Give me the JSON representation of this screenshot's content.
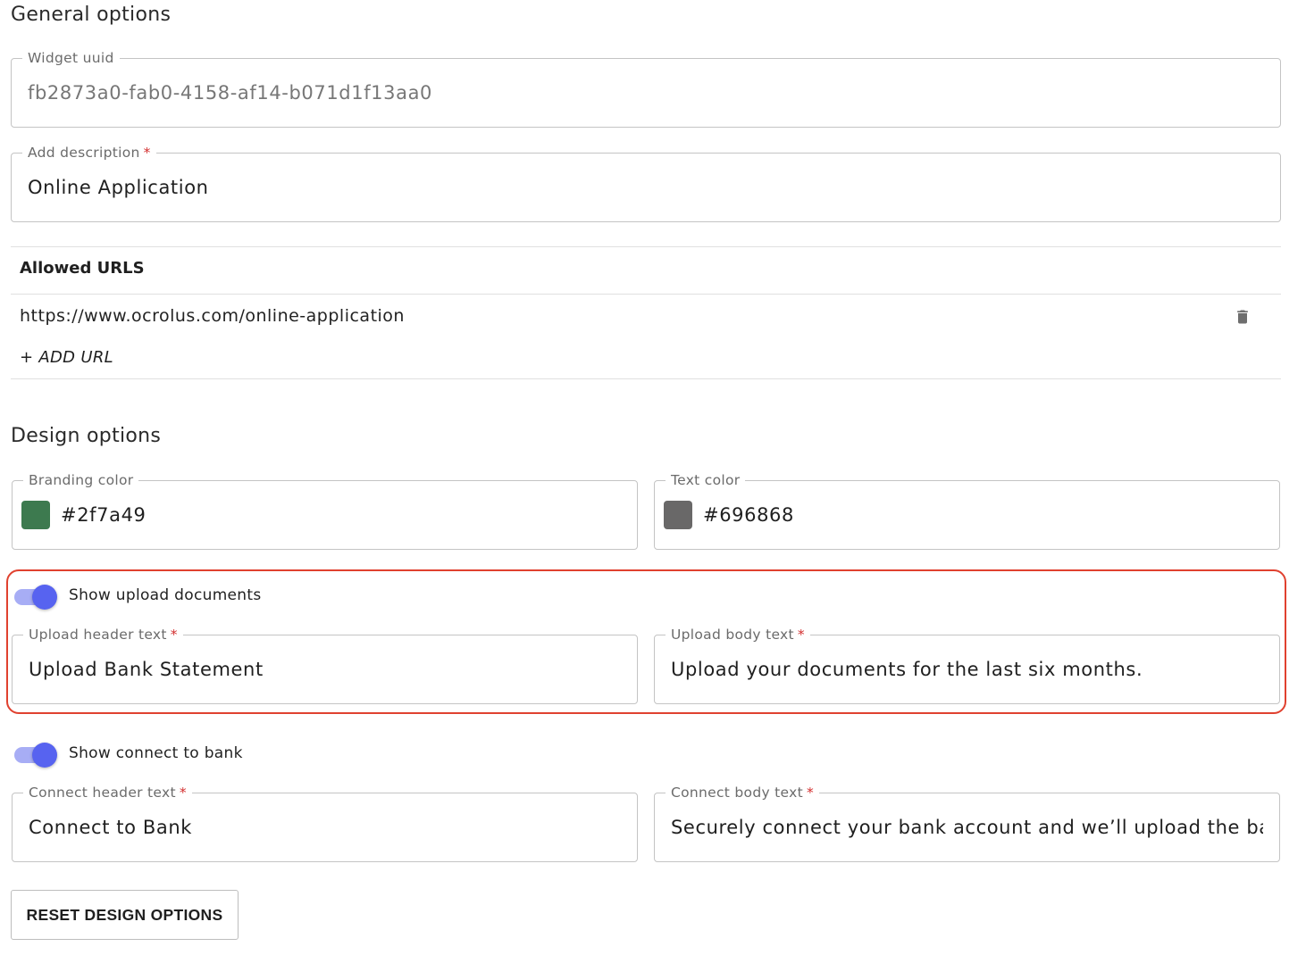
{
  "general": {
    "title": "General options",
    "widget_uuid": {
      "label": "Widget uuid",
      "value": "fb2873a0-fab0-4158-af14-b071d1f13aa0"
    },
    "description": {
      "label": "Add description",
      "required_mark": "*",
      "value": "Online Application"
    }
  },
  "allowed_urls": {
    "header": "Allowed URLS",
    "items": [
      {
        "url": "https://www.ocrolus.com/online-application",
        "delete_icon": "trash-icon"
      }
    ],
    "add_label": "+ ADD URL"
  },
  "design": {
    "title": "Design options",
    "branding_color": {
      "label": "Branding color",
      "value": "#2f7a49",
      "swatch": "#3d7a4f"
    },
    "text_color": {
      "label": "Text color",
      "value": "#696868",
      "swatch": "#696868"
    },
    "upload": {
      "toggle_label": "Show upload documents",
      "enabled": true,
      "header": {
        "label": "Upload header text",
        "required_mark": "*",
        "value": "Upload Bank Statement"
      },
      "body": {
        "label": "Upload body text",
        "required_mark": "*",
        "value": "Upload your documents for the last six months."
      }
    },
    "connect": {
      "toggle_label": "Show connect to bank",
      "enabled": true,
      "header": {
        "label": "Connect header text",
        "required_mark": "*",
        "value": "Connect to Bank"
      },
      "body": {
        "label": "Connect body text",
        "required_mark": "*",
        "value": "Securely connect your bank account and we’ll upload the bar"
      }
    },
    "reset_label": "RESET DESIGN OPTIONS"
  },
  "colors": {
    "toggle_thumb": "#5763f0",
    "toggle_track": "#a7adf5",
    "highlight": "#e0412f",
    "required": "#d32f2f"
  }
}
